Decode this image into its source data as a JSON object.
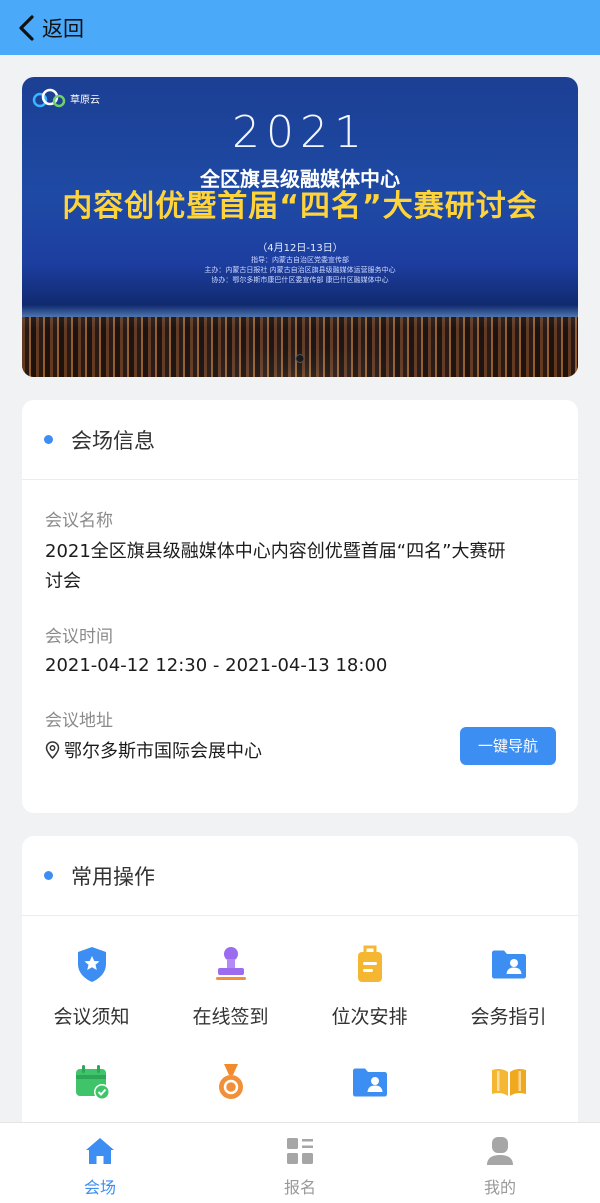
{
  "header": {
    "back_label": "返回"
  },
  "banner": {
    "logo_text": "草原云",
    "year": "2021",
    "subtitle": "全区旗县级融媒体中心",
    "title": "内容创优暨首届“四名”大赛研讨会",
    "date": "（4月12日-13日）",
    "fine_lines": [
      "指导：内蒙古自治区党委宣传部",
      "主办：内蒙古日报社 内蒙古自治区旗县级融媒体运营服务中心",
      "协办：鄂尔多斯市康巴什区委宣传部 康巴什区融媒体中心"
    ],
    "carousel_pages": 1,
    "carousel_active": 1
  },
  "venue": {
    "section_title": "会场信息",
    "name_label": "会议名称",
    "name_line1": "2021全区旗县级融媒体中心内容创优暨首届“四名”大赛研",
    "name_line2": "讨会",
    "time_label": "会议时间",
    "time_value": "2021-04-12 12:30 - 2021-04-13 18:00",
    "address_label": "会议地址",
    "address_value": "鄂尔多斯市国际会展中心",
    "nav_button": "一键导航"
  },
  "operations": {
    "section_title": "常用操作",
    "items": [
      {
        "label": "会议须知",
        "icon": "shield-star-icon",
        "color": "#3d8ef2"
      },
      {
        "label": "在线签到",
        "icon": "stamp-icon",
        "color": "#9b6bf0"
      },
      {
        "label": "位次安排",
        "icon": "seat-tag-icon",
        "color": "#f5b731"
      },
      {
        "label": "会务指引",
        "icon": "folder-user-icon",
        "color": "#3d8ef2"
      },
      {
        "label": "",
        "icon": "calendar-check-icon",
        "color": "#3fc46a"
      },
      {
        "label": "",
        "icon": "medal-icon",
        "color": "#f2903a"
      },
      {
        "label": "",
        "icon": "folder-contact-icon",
        "color": "#3d8ef2"
      },
      {
        "label": "",
        "icon": "book-icon",
        "color": "#f5b731"
      }
    ]
  },
  "tabbar": {
    "items": [
      {
        "label": "会场",
        "icon": "home-icon",
        "active": true
      },
      {
        "label": "报名",
        "icon": "grid-list-icon",
        "active": false
      },
      {
        "label": "我的",
        "icon": "user-icon",
        "active": false
      }
    ],
    "active_color": "#3d8ef2",
    "inactive_color": "#999999"
  }
}
